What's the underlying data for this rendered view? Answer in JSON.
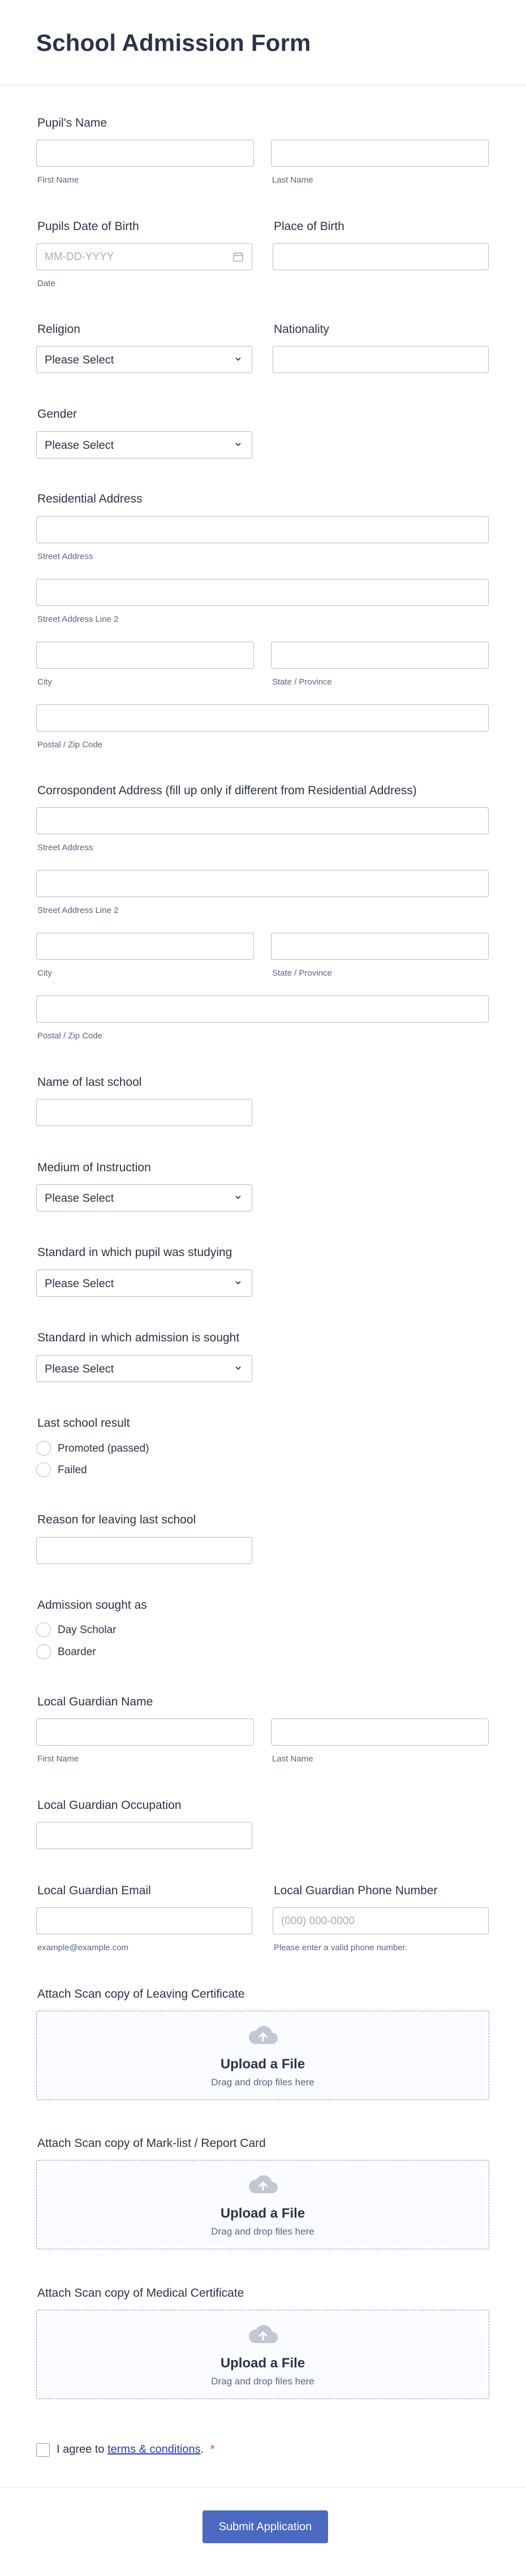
{
  "header": {
    "title": "School Admission Form"
  },
  "pupil_name": {
    "label": "Pupil's Name",
    "first_sub": "First Name",
    "last_sub": "Last Name"
  },
  "dob": {
    "label": "Pupils Date of Birth",
    "placeholder": "MM-DD-YYYY",
    "sub": "Date"
  },
  "place_of_birth": {
    "label": "Place of Birth"
  },
  "religion": {
    "label": "Religion",
    "value": "Please Select"
  },
  "nationality": {
    "label": "Nationality"
  },
  "gender": {
    "label": "Gender",
    "value": "Please Select"
  },
  "residential": {
    "label": "Residential Address",
    "street": "Street Address",
    "street2": "Street Address Line 2",
    "city": "City",
    "state": "State / Province",
    "zip": "Postal / Zip Code"
  },
  "correspondent": {
    "label": "Corrospondent Address (fill up only if different from Residential Address)",
    "street": "Street Address",
    "street2": "Street Address Line 2",
    "city": "City",
    "state": "State / Province",
    "zip": "Postal / Zip Code"
  },
  "last_school": {
    "label": "Name of last school"
  },
  "medium": {
    "label": "Medium of Instruction",
    "value": "Please Select"
  },
  "standard_studying": {
    "label": "Standard in which pupil was studying",
    "value": "Please Select"
  },
  "standard_sought": {
    "label": "Standard in which admission is sought",
    "value": "Please Select"
  },
  "last_result": {
    "label": "Last school result",
    "options": [
      "Promoted (passed)",
      "Failed"
    ]
  },
  "reason": {
    "label": "Reason for leaving last school"
  },
  "admission_as": {
    "label": "Admission sought as",
    "options": [
      "Day Scholar",
      "Boarder"
    ]
  },
  "guardian_name": {
    "label": "Local Guardian Name",
    "first_sub": "First Name",
    "last_sub": "Last Name"
  },
  "guardian_occupation": {
    "label": "Local Guardian Occupation"
  },
  "guardian_email": {
    "label": "Local Guardian Email",
    "sub": "example@example.com"
  },
  "guardian_phone": {
    "label": "Local Guardian Phone Number",
    "placeholder": "(000) 000-0000",
    "sub": "Please enter a valid phone number."
  },
  "uploads": [
    {
      "label": "Attach Scan copy of Leaving Certificate",
      "title": "Upload a File",
      "sub": "Drag and drop files here"
    },
    {
      "label": "Attach Scan copy of Mark-list / Report Card",
      "title": "Upload a File",
      "sub": "Drag and drop files here"
    },
    {
      "label": "Attach Scan copy of Medical Certificate",
      "title": "Upload a File",
      "sub": "Drag and drop files here"
    }
  ],
  "terms": {
    "prefix": "I agree to ",
    "link": "terms & conditions",
    "suffix": ".",
    "required": "*"
  },
  "submit": {
    "label": "Submit Application"
  },
  "icons": {
    "chevron": "chevron-down-icon",
    "calendar": "calendar-icon",
    "upload": "cloud-upload-icon"
  },
  "colors": {
    "accent": "#4b69c0",
    "link": "#2b3ea3",
    "required": "#f23a3c",
    "border": "#b8bdc9"
  }
}
